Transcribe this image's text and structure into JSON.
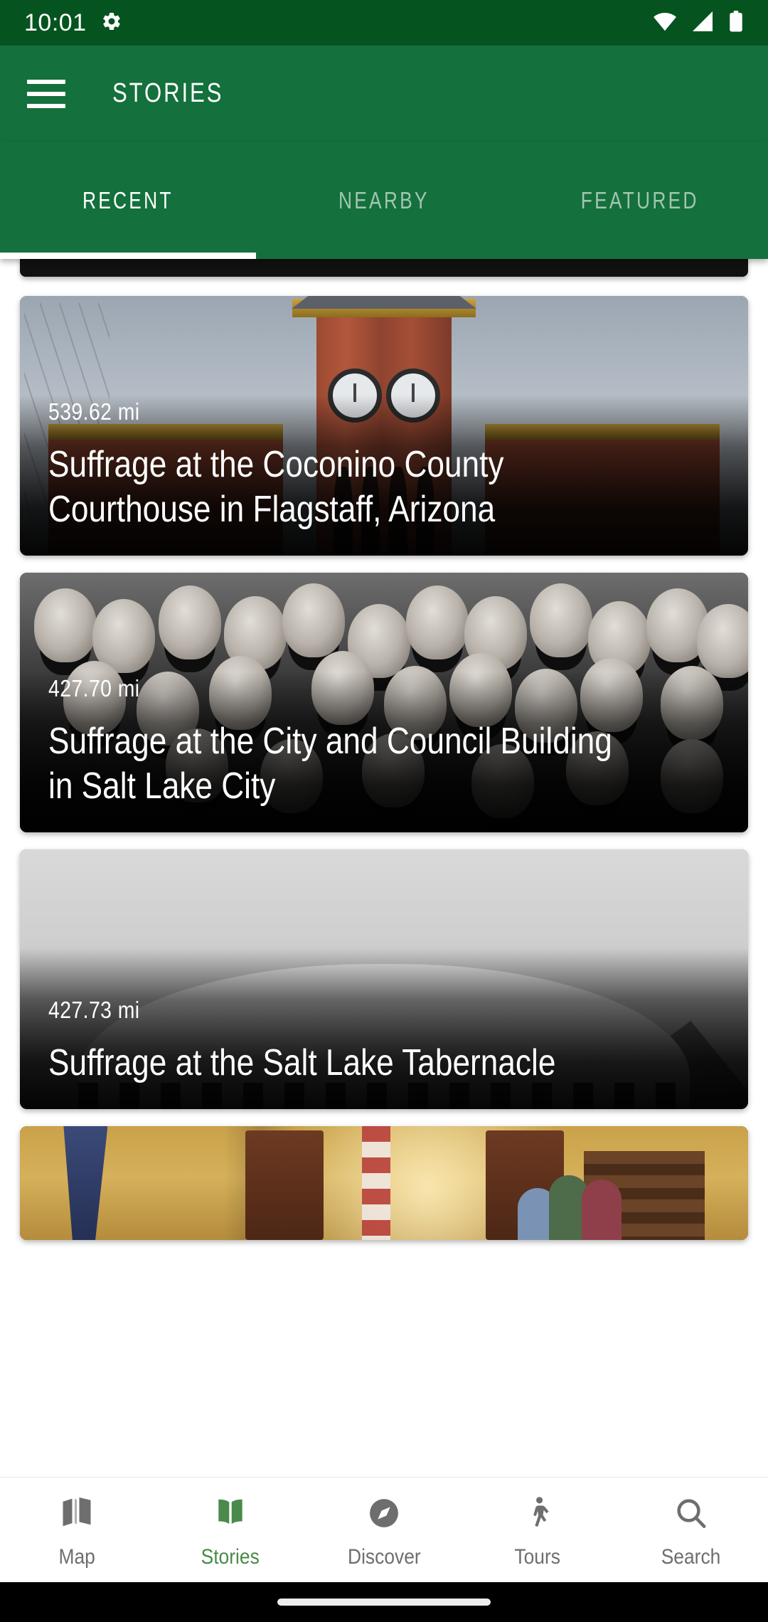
{
  "status_bar": {
    "time": "10:01",
    "icons": [
      "gear-icon",
      "wifi-icon",
      "cellular-signal-icon",
      "battery-icon"
    ],
    "background": "#05541f"
  },
  "app_bar": {
    "menu_icon": "hamburger-menu-icon",
    "title": "STORIES",
    "background": "#14703c"
  },
  "tabs": {
    "active_index": 0,
    "items": [
      {
        "label": "RECENT"
      },
      {
        "label": "NEARBY"
      },
      {
        "label": "FEATURED"
      }
    ]
  },
  "stories": [
    {
      "distance": "539.62 mi",
      "title": "Suffrage at the Coconino County Courthouse in Flagstaff, Arizona",
      "image_alt": "red brick clock tower courthouse under gray cloudy sky"
    },
    {
      "distance": "427.70 mi",
      "title": "Suffrage at the City and Council Building in Salt Lake City",
      "image_alt": "black and white historical group portrait of women in Victorian dress"
    },
    {
      "distance": "427.73 mi",
      "title": "Suffrage at the Salt Lake Tabernacle",
      "image_alt": "black and white photograph of the domed Salt Lake Tabernacle roof"
    },
    {
      "distance": "",
      "title": "",
      "image_alt": "painted interior scene with yellow walls, flag, wooden doors and figures"
    }
  ],
  "bottom_nav": {
    "active_index": 1,
    "active_color": "#4a8a4a",
    "inactive_color": "#6e6e6e",
    "items": [
      {
        "label": "Map",
        "icon": "folded-map-icon"
      },
      {
        "label": "Stories",
        "icon": "open-book-icon"
      },
      {
        "label": "Discover",
        "icon": "compass-icon"
      },
      {
        "label": "Tours",
        "icon": "walking-person-icon"
      },
      {
        "label": "Search",
        "icon": "magnifier-icon"
      }
    ]
  }
}
